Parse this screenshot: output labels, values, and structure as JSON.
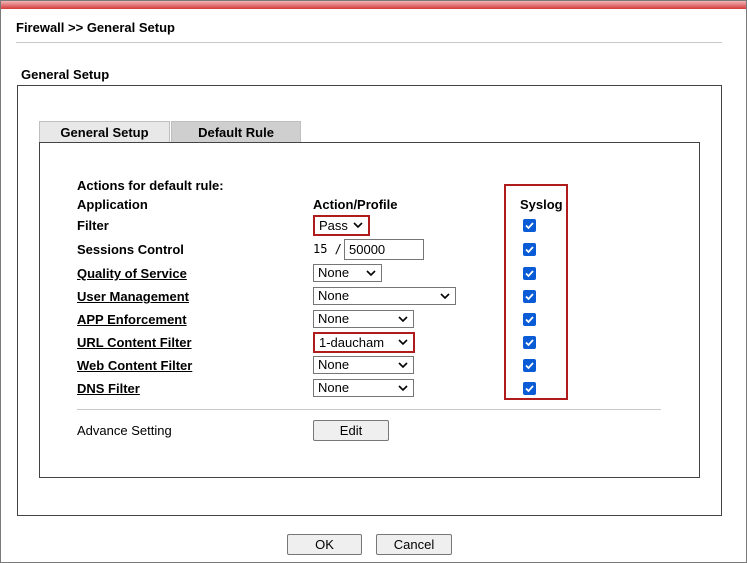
{
  "breadcrumb": "Firewall >> General Setup",
  "section_title": "General Setup",
  "tabs": [
    {
      "label": "General Setup",
      "active": false
    },
    {
      "label": "Default Rule",
      "active": true
    }
  ],
  "heading": "Actions for default rule:",
  "columns": {
    "application": "Application",
    "action": "Action/Profile",
    "syslog": "Syslog"
  },
  "rows": {
    "filter": {
      "label": "Filter",
      "value": "Pass",
      "syslog": true
    },
    "sessions": {
      "label": "Sessions Control",
      "current": "15 /",
      "limit": "50000",
      "syslog": true
    },
    "qos": {
      "label": "Quality of Service",
      "value": "None",
      "syslog": true
    },
    "user_mgmt": {
      "label": "User Management",
      "value": "None",
      "syslog": true
    },
    "app_enf": {
      "label": "APP Enforcement",
      "value": "None",
      "syslog": true
    },
    "url_filter": {
      "label": "URL Content Filter",
      "value": "1-daucham",
      "syslog": true
    },
    "web_filter": {
      "label": "Web Content Filter",
      "value": "None",
      "syslog": true
    },
    "dns_filter": {
      "label": "DNS Filter",
      "value": "None",
      "syslog": true
    }
  },
  "advance": {
    "label": "Advance Setting",
    "button": "Edit"
  },
  "footer": {
    "ok": "OK",
    "cancel": "Cancel"
  },
  "colors": {
    "highlight": "#b01c1c",
    "checkbox": "#0a5bd6",
    "topbar": "#d43a3a"
  }
}
